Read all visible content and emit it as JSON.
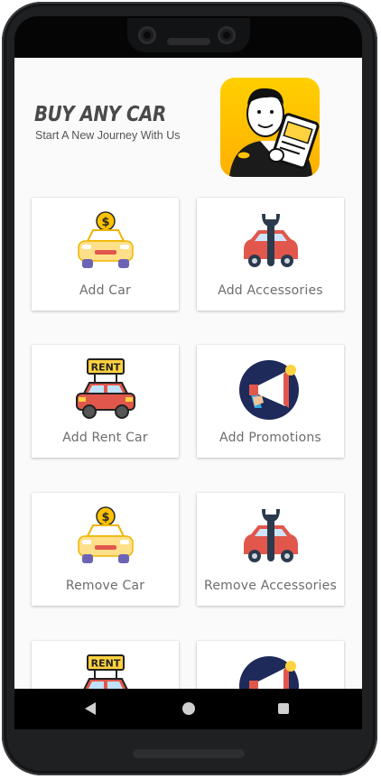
{
  "header": {
    "title": "BUY ANY CAR",
    "subtitle": "Start A New Journey With Us"
  },
  "cards": [
    {
      "label": "Add Car",
      "icon": "car-dollar-icon"
    },
    {
      "label": "Add Accessories",
      "icon": "car-wrench-icon"
    },
    {
      "label": "Add Rent Car",
      "icon": "rent-car-icon",
      "sign_text": "RENT"
    },
    {
      "label": "Add Promotions",
      "icon": "megaphone-icon"
    },
    {
      "label": "Remove Car",
      "icon": "car-dollar-icon"
    },
    {
      "label": "Remove Accessories",
      "icon": "car-wrench-icon"
    },
    {
      "label": "",
      "icon": "rent-car-icon",
      "sign_text": "RENT"
    },
    {
      "label": "",
      "icon": "megaphone-icon"
    }
  ],
  "navbar": {
    "back": "back-icon",
    "home": "home-icon",
    "recents": "recents-icon"
  },
  "colors": {
    "accent_yellow": "#ffc200",
    "car_red": "#e2574c",
    "navy": "#1e2a5a",
    "text_gray": "#6d6d6d"
  }
}
